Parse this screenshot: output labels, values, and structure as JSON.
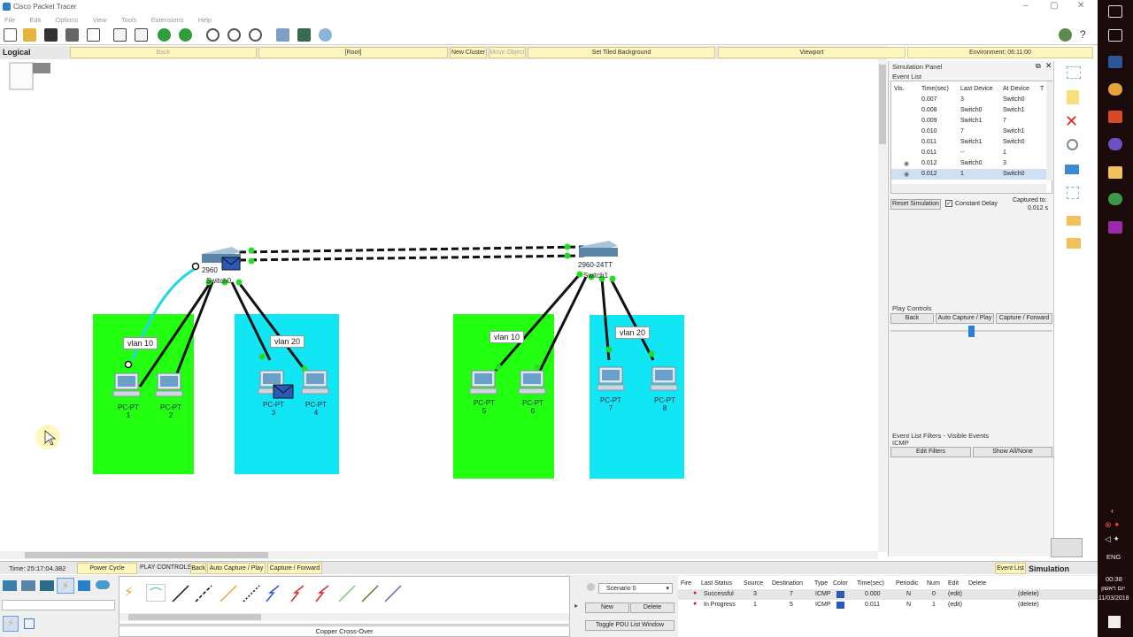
{
  "window": {
    "title": "Cisco Packet Tracer"
  },
  "menu": [
    "File",
    "Edit",
    "Options",
    "View",
    "Tools",
    "Extensions",
    "Help"
  ],
  "logical_bar": {
    "label": "Logical",
    "back": "Back",
    "root": "[Root]",
    "new_cluster": "New Cluster",
    "move_object": "Move Object",
    "set_tiled_background": "Set Tiled Background",
    "viewport": "Viewport",
    "environment": "Environment: 06:11:00"
  },
  "topology": {
    "switch0": {
      "model": "2960",
      "name": "Switch0"
    },
    "switch1": {
      "model": "2960-24TT",
      "name": "Switch1"
    },
    "vlan_labels": [
      "vlan 10",
      "vlan 20",
      "vlan 10",
      "vlan 20"
    ],
    "pcs": [
      {
        "type": "PC-PT",
        "id": "1"
      },
      {
        "type": "PC-PT",
        "id": "2"
      },
      {
        "type": "PC-PT",
        "id": "3"
      },
      {
        "type": "PC-PT",
        "id": "4"
      },
      {
        "type": "PC-PT",
        "id": "5"
      },
      {
        "type": "PC-PT",
        "id": "6"
      },
      {
        "type": "PC-PT",
        "id": "7"
      },
      {
        "type": "PC-PT",
        "id": "8"
      }
    ],
    "colors": {
      "green_zone": "#22ff11",
      "cyan_zone": "#11e6f5",
      "link": "#111111",
      "link_cyan": "#22d6e6",
      "port_up": "#22dd22"
    }
  },
  "simulation_panel": {
    "title": "Simulation Panel",
    "event_list_label": "Event List",
    "columns": [
      "Vis.",
      "Time(sec)",
      "Last Device",
      "At Device",
      "T"
    ],
    "events": [
      {
        "time": "0.007",
        "last": "3",
        "at": "Switch0"
      },
      {
        "time": "0.008",
        "last": "Switch0",
        "at": "Switch1"
      },
      {
        "time": "0.009",
        "last": "Switch1",
        "at": "7"
      },
      {
        "time": "0.010",
        "last": "7",
        "at": "Switch1"
      },
      {
        "time": "0.011",
        "last": "Switch1",
        "at": "Switch0"
      },
      {
        "time": "0.011",
        "last": "--",
        "at": "1"
      },
      {
        "time": "0.012",
        "last": "Switch0",
        "at": "3"
      },
      {
        "time": "0.012",
        "last": "1",
        "at": "Switch0"
      }
    ],
    "reset_simulation": "Reset Simulation",
    "constant_delay": "Constant Delay",
    "captured_to_label": "Captured to:",
    "captured_to_value": "0.012 s",
    "play_controls": "Play Controls",
    "back": "Back",
    "auto_capture_play": "Auto Capture / Play",
    "capture_forward": "Capture / Forward",
    "filters_label": "Event List Filters - Visible Events",
    "filters_value": "ICMP",
    "edit_filters": "Edit Filters",
    "show_all_none": "Show All/None"
  },
  "status_row": {
    "time": "Time: 25:17:04.382",
    "power_cycle": "Power Cycle Devices",
    "play_controls": "PLAY CONTROLS:",
    "back": "Back",
    "auto_capture": "Auto Capture / Play",
    "capture_forward": "Capture / Forward",
    "event_list": "Event List",
    "simulation": "Simulation"
  },
  "bottom": {
    "device_caption": "Copper Cross-Over",
    "scenario": "Scenario 0",
    "new": "New",
    "delete": "Delete",
    "toggle_pdu": "Toggle PDU List Window",
    "pdu_columns": [
      "Fire",
      "Last Status",
      "Source",
      "Destination",
      "Type",
      "Color",
      "Time(sec)",
      "Periodic",
      "Num",
      "Edit",
      "Delete"
    ],
    "pdus": [
      {
        "status": "Successful",
        "source": "3",
        "destination": "7",
        "type": "ICMP",
        "color": "#2b59b8",
        "time": "0.000",
        "periodic": "N",
        "num": "0",
        "edit": "(edit)",
        "delete": "(delete)"
      },
      {
        "status": "In Progress",
        "source": "1",
        "destination": "5",
        "type": "ICMP",
        "color": "#2b59b8",
        "time": "0.011",
        "periodic": "N",
        "num": "1",
        "edit": "(edit)",
        "delete": "(delete)"
      }
    ]
  },
  "taskbar": {
    "lang": "ENG",
    "time": "00:38",
    "day": "יום ראשון",
    "date": "11/03/2018"
  }
}
